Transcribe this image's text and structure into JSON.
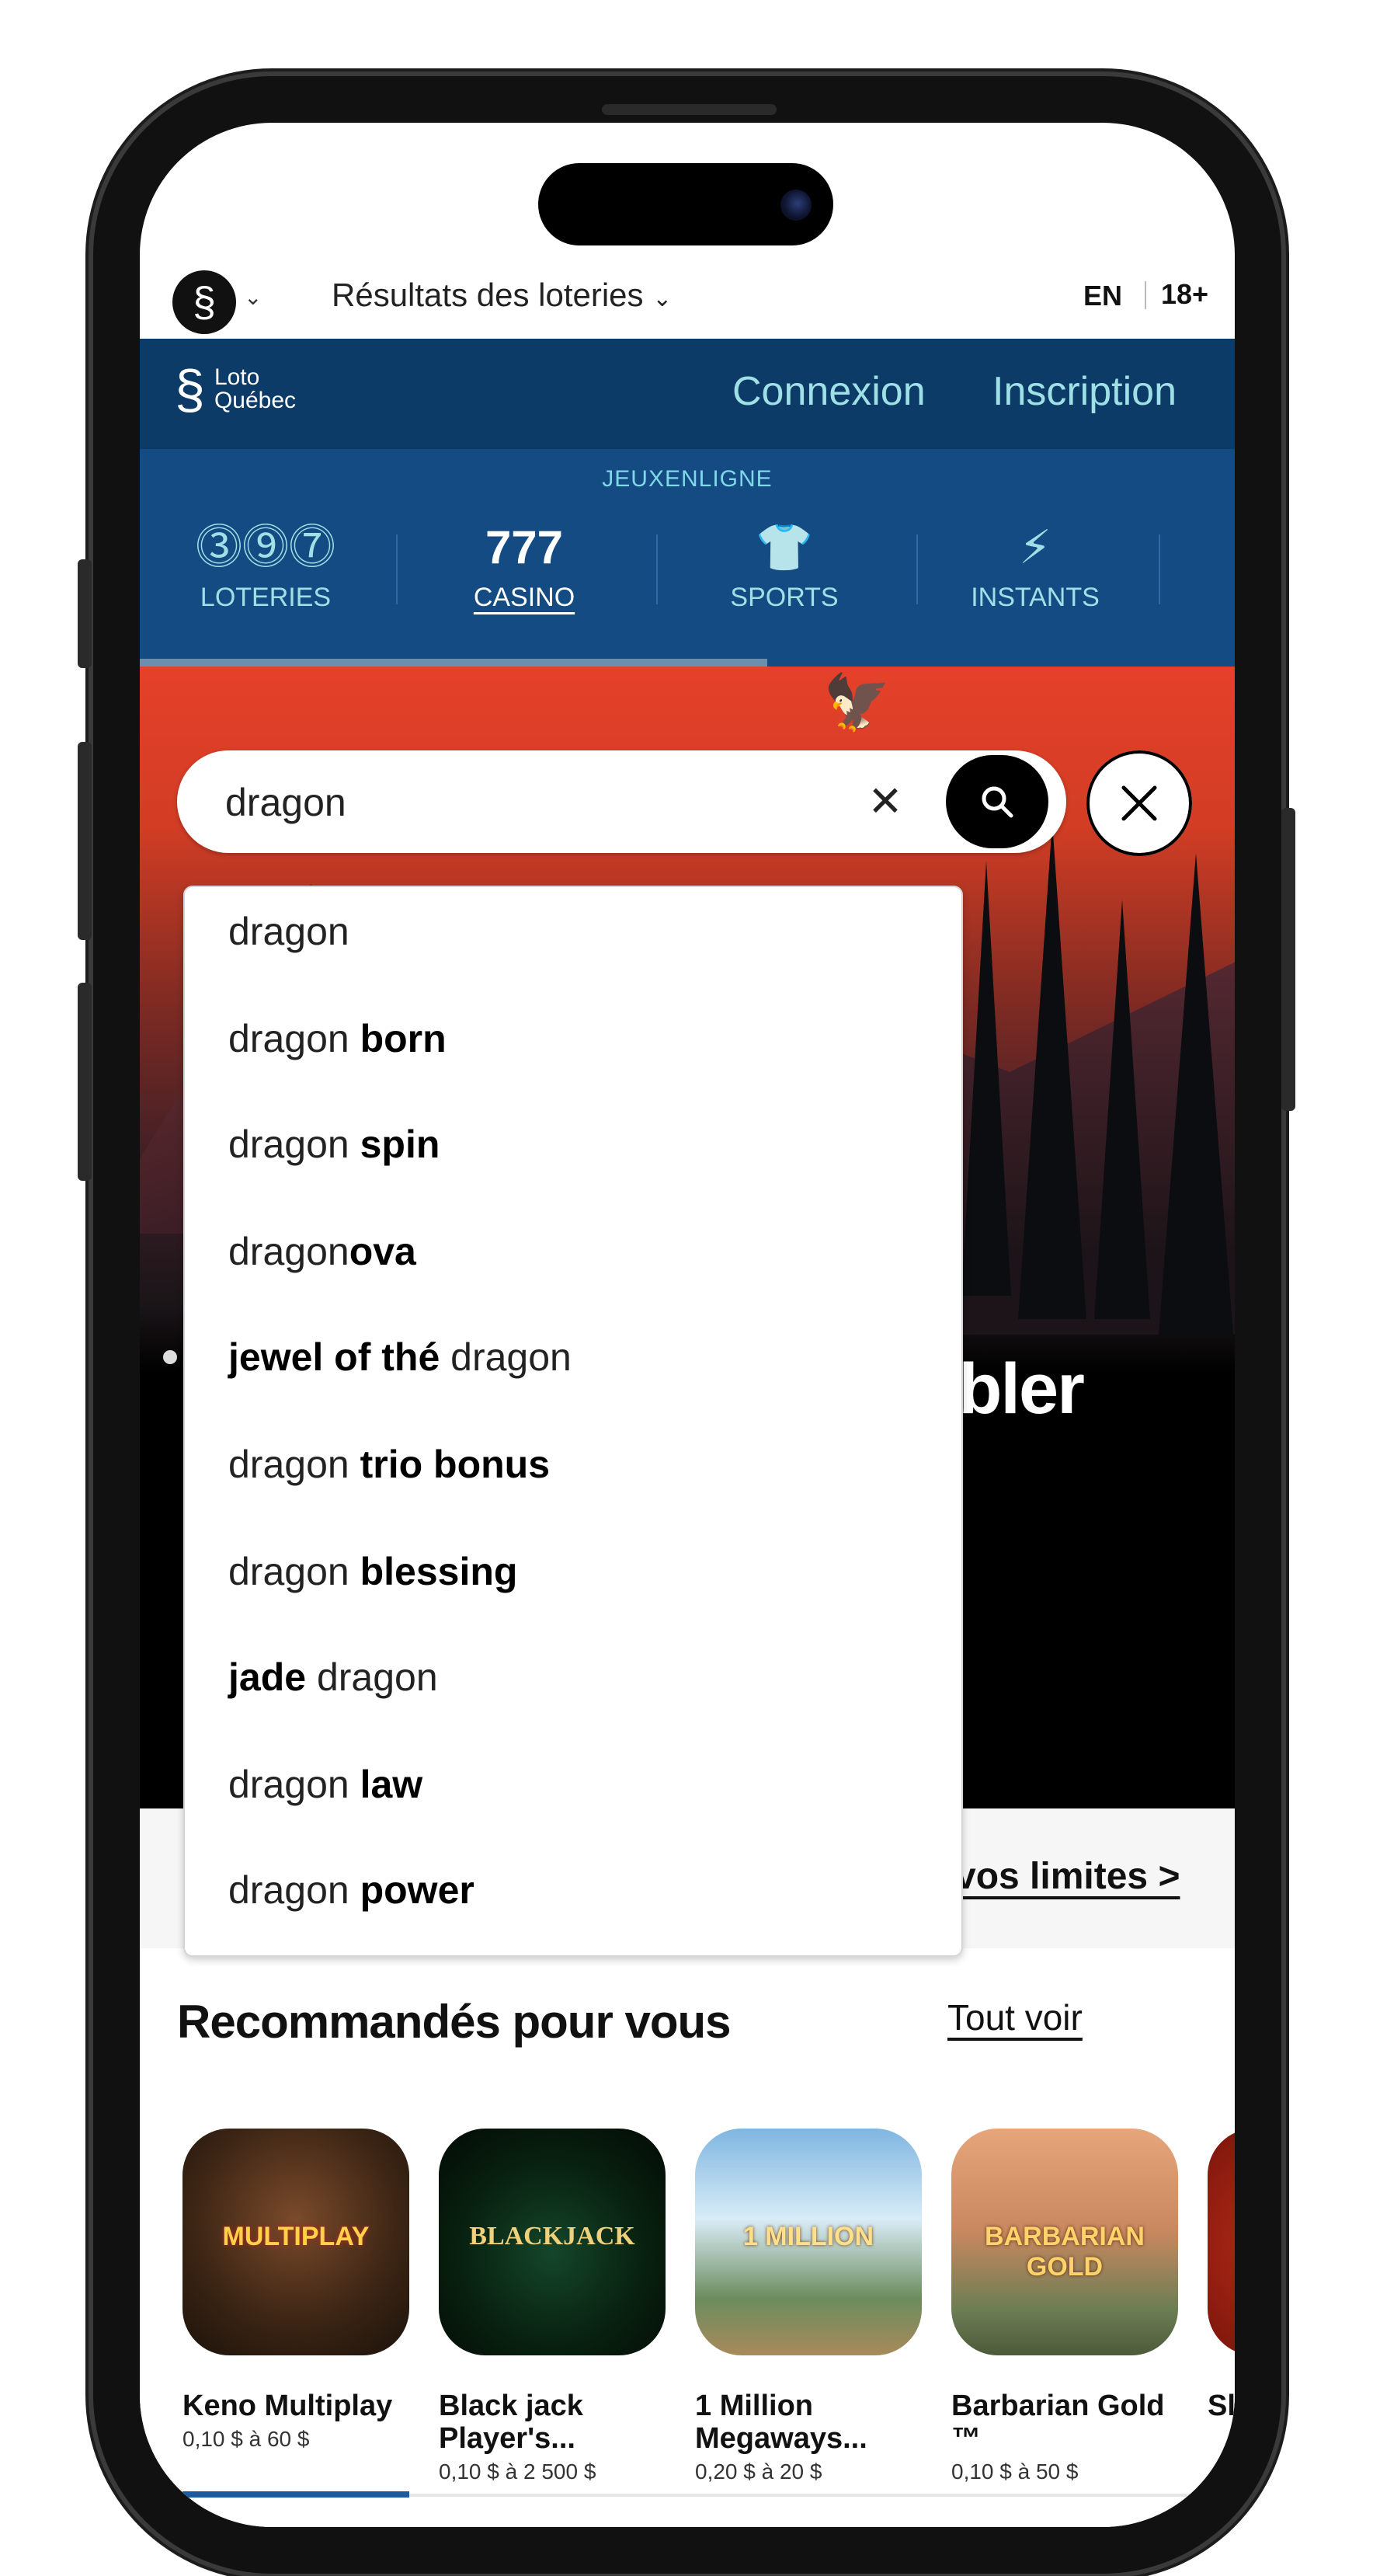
{
  "topbar": {
    "results_label": "Résultats des loteries",
    "lang": "EN",
    "age": "18+"
  },
  "header": {
    "brand_line1": "Loto",
    "brand_line2": "Québec",
    "login_label": "Connexion",
    "signup_label": "Inscription"
  },
  "nav": {
    "heading": "JEUXENLIGNE",
    "items": [
      {
        "label": "LOTERIES",
        "icon": "lottery-balls-icon"
      },
      {
        "label": "CASINO",
        "icon": "slot-777-icon",
        "active": true
      },
      {
        "label": "SPORTS",
        "icon": "jersey-icon"
      },
      {
        "label": "INSTANTS",
        "icon": "lightning-icon"
      }
    ]
  },
  "search": {
    "value": "dragon",
    "placeholder": "",
    "suggestions": [
      {
        "normal_before": "dragon",
        "bold": "",
        "normal_after": ""
      },
      {
        "normal_before": "dragon ",
        "bold": "born",
        "normal_after": ""
      },
      {
        "normal_before": "dragon ",
        "bold": "spin",
        "normal_after": ""
      },
      {
        "normal_before": "dragon",
        "bold": "ova",
        "normal_after": ""
      },
      {
        "normal_before": "",
        "bold": "jewel of thé",
        "normal_after": " dragon"
      },
      {
        "normal_before": "dragon ",
        "bold": "trio bonus",
        "normal_after": ""
      },
      {
        "normal_before": "dragon ",
        "bold": "blessing",
        "normal_after": ""
      },
      {
        "normal_before": "",
        "bold": "jade",
        "normal_after": " dragon"
      },
      {
        "normal_before": "dragon ",
        "bold": "law",
        "normal_after": ""
      },
      {
        "normal_before": "dragon ",
        "bold": "power",
        "normal_after": ""
      }
    ]
  },
  "hero": {
    "title_fragment": "ubler"
  },
  "limits": {
    "link_label": "vos limites >"
  },
  "recommended": {
    "title": "Recommandés pour vous",
    "see_all": "Tout voir",
    "games": [
      {
        "name": "Keno Multiplay",
        "range": "0,10 $ à 60 $",
        "tile_text": "MULTIPLAY"
      },
      {
        "name": "Black jack Player's...",
        "range": "0,10 $ à 2 500 $",
        "tile_text": "BLACKJACK"
      },
      {
        "name": "1 Million Megaways...",
        "range": "0,20 $ à 20 $",
        "tile_text": "1 MILLION"
      },
      {
        "name": "Barbarian Gold ™",
        "range": "0,10 $ à 50 $",
        "tile_text": "BARBARIAN GOLD"
      },
      {
        "name": "Sl X",
        "range": "",
        "tile_text": ""
      }
    ]
  }
}
